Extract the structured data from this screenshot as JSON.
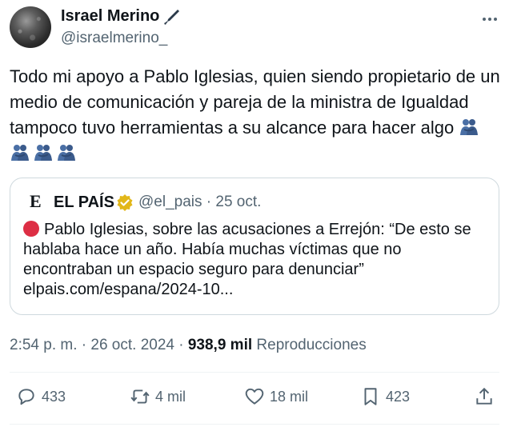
{
  "author": {
    "name": "Israel Merino",
    "handle": "@israelmerino_"
  },
  "tweet": {
    "text": "Todo mi apoyo a Pablo Iglesias, quien siendo propietario de un medio de comunicación y pareja de la ministra de Igualdad tampoco tuvo herramientas a su alcance para hacer algo "
  },
  "quote": {
    "logo": "E",
    "name": "EL PAÍS",
    "handle_date": "@el_pais · 25 oct.",
    "text": "Pablo Iglesias, sobre las acusaciones a Errejón: “De esto se hablaba hace un año. Había muchas víctimas que no encontraban un espacio seguro para denunciar”",
    "link": "elpais.com/espana/2024-10..."
  },
  "meta": {
    "time": "2:54 p. m. · 26 oct. 2024 · ",
    "views": "938,9 mil",
    "views_label": " Reproducciones"
  },
  "actions": {
    "replies": "433",
    "retweets": "4 mil",
    "likes": "18 mil",
    "bookmarks": "423"
  },
  "colors": {
    "text": "#0f1419",
    "secondary": "#536471",
    "border": "#cfd9de",
    "verified_gold": "#e2b719",
    "red_dot": "#dd2e44",
    "hug_blue": "#4a6fa5"
  },
  "icons": [
    "pen-icon",
    "more-icon",
    "hug-icon",
    "verified-icon",
    "red-circle-icon",
    "reply-icon",
    "retweet-icon",
    "like-icon",
    "bookmark-icon",
    "share-icon"
  ]
}
